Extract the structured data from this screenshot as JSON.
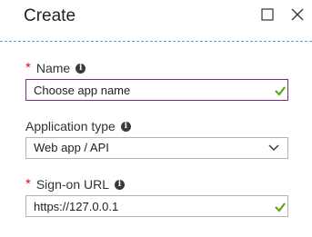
{
  "blade": {
    "title": "Create"
  },
  "window_controls": {
    "maximize_icon": "square-icon",
    "close_icon": "close-icon"
  },
  "form": {
    "name": {
      "label": "Name",
      "required": true,
      "value": "Choose app name",
      "valid": true
    },
    "application_type": {
      "label": "Application type",
      "required": false,
      "selected": "Web app / API"
    },
    "sign_on_url": {
      "label": "Sign-on URL",
      "required": true,
      "value": "https://127.0.0.1",
      "valid": true
    }
  },
  "colors": {
    "required_asterisk": "#e00b1c",
    "valid_check": "#57a300",
    "focus_border": "#7b2c8b",
    "divider": "#5aa0d6"
  }
}
